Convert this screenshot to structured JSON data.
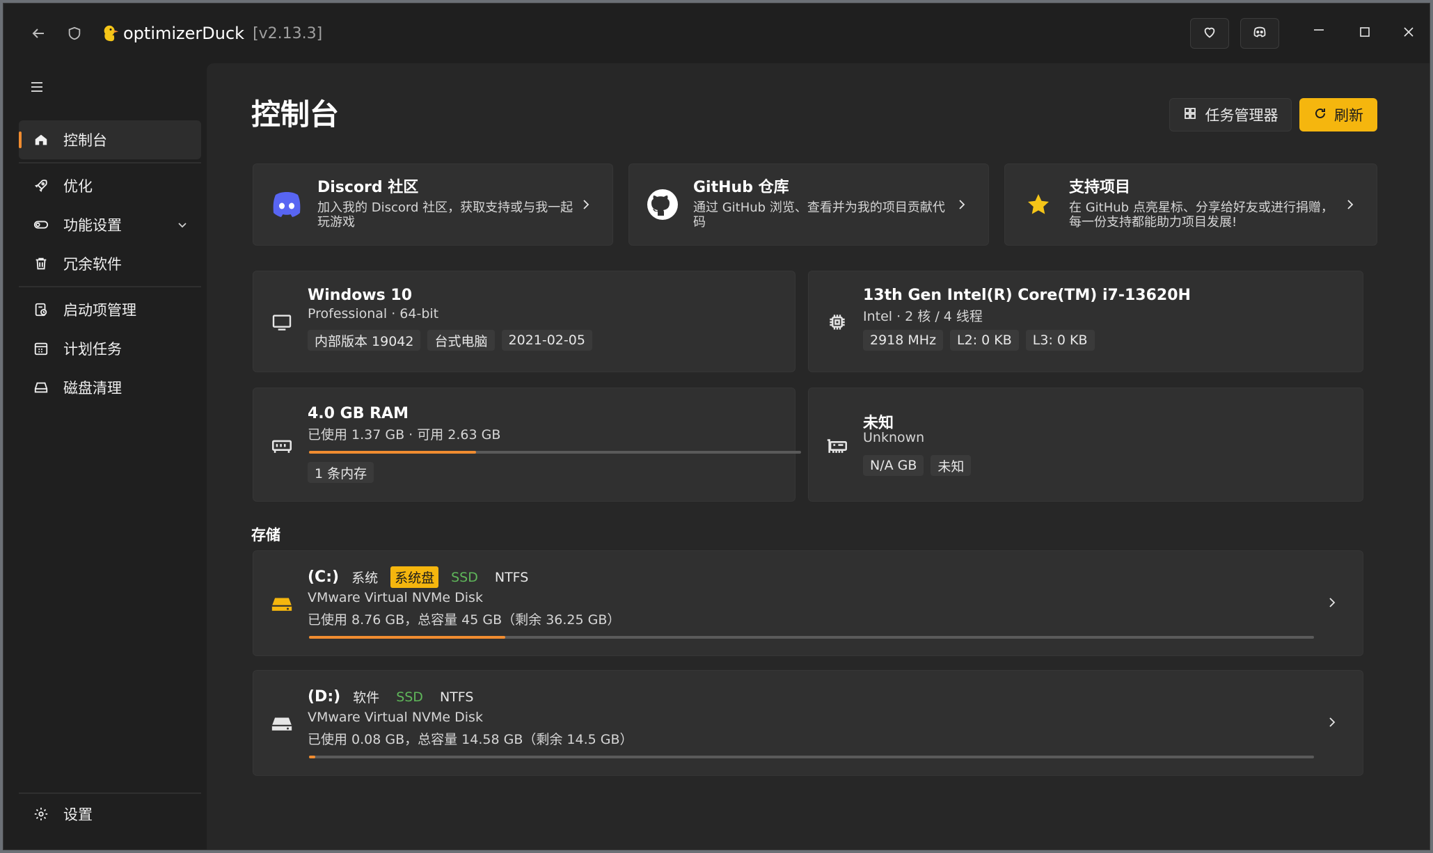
{
  "titlebar": {
    "app_name": "optimizerDuck",
    "version": "[v2.13.3]",
    "icons": [
      "back-arrow-icon",
      "shield-icon",
      "duck-logo-icon"
    ],
    "buttons": [
      "heart-icon",
      "discord-icon"
    ],
    "controls": [
      "minimize-icon",
      "maximize-icon",
      "close-icon"
    ]
  },
  "sidebar": {
    "items": [
      {
        "label": "控制台",
        "icon": "home-icon",
        "active": true
      },
      {
        "label": "优化",
        "icon": "rocket-icon"
      },
      {
        "label": "功能设置",
        "icon": "toggle-icon",
        "expandable": true
      },
      {
        "label": "冗余软件",
        "icon": "trash-icon"
      },
      {
        "label": "启动项管理",
        "icon": "startup-icon"
      },
      {
        "label": "计划任务",
        "icon": "calendar-icon"
      },
      {
        "label": "磁盘清理",
        "icon": "disk-icon"
      }
    ],
    "settings_label": "设置"
  },
  "main": {
    "title": "控制台",
    "task_manager_label": "任务管理器",
    "refresh_label": "刷新",
    "links": [
      {
        "title": "Discord 社区",
        "desc": "加入我的 Discord 社区，获取支持或与我一起玩游戏",
        "icon": "discord-icon",
        "color": "#5865f2"
      },
      {
        "title": "GitHub 仓库",
        "desc": "通过 GitHub 浏览、查看并为我的项目贡献代码",
        "icon": "github-icon",
        "color": "#ffffff"
      },
      {
        "title": "支持项目",
        "desc": "在 GitHub 点亮星标、分享给好友或进行捐赠，每一份支持都能助力项目发展!",
        "icon": "star-icon",
        "color": "#f5c518"
      }
    ],
    "os": {
      "title": "Windows 10",
      "sub": "Professional · 64-bit",
      "chips": [
        "内部版本 19042",
        "台式电脑",
        "2021-02-05"
      ]
    },
    "cpu": {
      "title": "13th Gen Intel(R) Core(TM) i7-13620H",
      "sub": "Intel · 2 核 / 4 线程",
      "chips": [
        "2918 MHz",
        "L2: 0 KB",
        "L3: 0 KB"
      ]
    },
    "ram": {
      "title": "4.0 GB RAM",
      "sub": "已使用 1.37 GB · 可用 2.63 GB",
      "usage": 0.34,
      "chips": [
        "1 条内存"
      ]
    },
    "gpu": {
      "title": "未知",
      "sub": "Unknown",
      "chips": [
        "N/A GB",
        "未知"
      ]
    },
    "storage_title": "存储",
    "drives": [
      {
        "letter": "(C:)",
        "tags": [
          {
            "text": "系统",
            "style": "plain"
          },
          {
            "text": "系统盘",
            "style": "yellow"
          },
          {
            "text": "SSD",
            "style": "green"
          },
          {
            "text": "NTFS",
            "style": "plain"
          }
        ],
        "model": "VMware Virtual NVMe Disk",
        "usage_text": "已使用 8.76 GB，总容量 45 GB（剩余 36.25 GB）",
        "usage": 0.195,
        "icon_color": "#f5b60e"
      },
      {
        "letter": "(D:)",
        "tags": [
          {
            "text": "软件",
            "style": "plain"
          },
          {
            "text": "SSD",
            "style": "green"
          },
          {
            "text": "NTFS",
            "style": "plain"
          }
        ],
        "model": "VMware Virtual NVMe Disk",
        "usage_text": "已使用 0.08 GB，总容量 14.58 GB（剩余 14.5 GB）",
        "usage": 0.006,
        "icon_color": "#e6e6e6"
      }
    ]
  },
  "colors": {
    "accent": "#f08c30",
    "refresh": "#f5b60e"
  }
}
